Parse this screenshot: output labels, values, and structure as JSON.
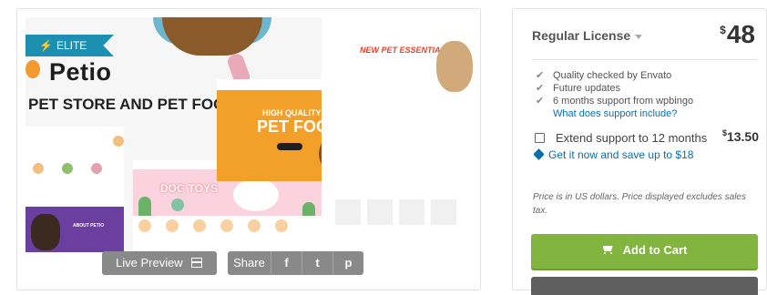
{
  "preview": {
    "badge": "ELITE",
    "logo": "Petio",
    "tagline": "PET STORE AND PET FOOD",
    "hero_title": "HIGH QUALITY",
    "hero_title2": "PET FOOD",
    "right_title": "NEW PET ESSENTIALS",
    "toys_title": "DOG TOYS",
    "purple_text": "ABOUT PETIO"
  },
  "actions": {
    "live_preview_label": "Live Preview",
    "share_label": "Share",
    "share_facebook": "f",
    "share_twitter": "t",
    "share_pinterest": "p"
  },
  "license": {
    "name": "Regular License",
    "currency": "$",
    "price": "48",
    "features": [
      "Quality checked by Envato",
      "Future updates",
      "6 months support from wpbingo"
    ],
    "support_link": "What does support include?",
    "extend_label": "Extend support to 12 months",
    "extend_currency": "$",
    "extend_price": "13.50",
    "save_text": "Get it now and save up to $18",
    "note": "Price is in US dollars. Price displayed excludes sales tax.",
    "cart_label": "Add to Cart"
  }
}
